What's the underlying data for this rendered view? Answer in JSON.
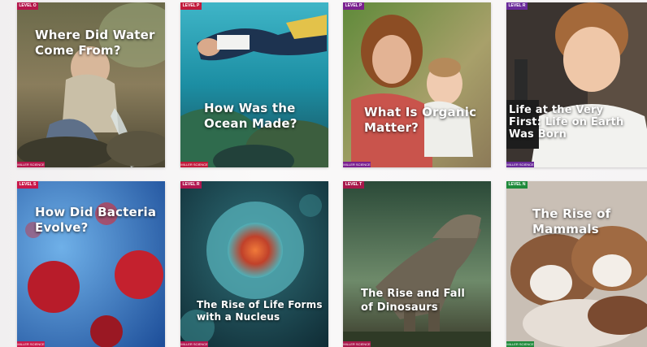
{
  "books": [
    {
      "level": "LEVEL O",
      "level_color": "#b5164b",
      "title_lines": [
        "Where Did Water",
        "Come From?"
      ],
      "brand": "MILLER SCIENCE",
      "brand_color": "#b5164b"
    },
    {
      "level": "LEVEL P",
      "level_color": "#c11a3b",
      "title_lines": [
        "How Was the",
        "Ocean Made?"
      ],
      "brand": "MILLER SCIENCE",
      "brand_color": "#c11a3b"
    },
    {
      "level": "LEVEL P",
      "level_color": "#7a1f8f",
      "title_lines": [
        "What Is Organic",
        "Matter?"
      ],
      "brand": "MILLER SCIENCE",
      "brand_color": "#7a1f8f"
    },
    {
      "level": "LEVEL R",
      "level_color": "#6a2a9a",
      "title_lines": [
        "Life at the Very",
        "First: Life on Earth",
        "Was Born"
      ],
      "brand": "MILLER SCIENCE",
      "brand_color": "#6a2a9a"
    },
    {
      "level": "LEVEL S",
      "level_color": "#c9184a",
      "title_lines": [
        "How Did Bacteria",
        "Evolve?"
      ],
      "brand": "MILLER SCIENCE",
      "brand_color": "#c9184a"
    },
    {
      "level": "LEVEL R",
      "level_color": "#b0164f",
      "title_lines": [
        "The Rise of Life Forms",
        "with a Nucleus"
      ],
      "brand": "MILLER SCIENCE",
      "brand_color": "#b0164f"
    },
    {
      "level": "LEVEL T",
      "level_color": "#a8174a",
      "title_lines": [
        "The Rise and Fall",
        "of Dinosaurs"
      ],
      "brand": "MILLER SCIENCE",
      "brand_color": "#a8174a"
    },
    {
      "level": "LEVEL N",
      "level_color": "#1f8a3b",
      "title_lines": [
        "The Rise of",
        "Mammals"
      ],
      "brand": "MILLER SCIENCE",
      "brand_color": "#1f8a3b"
    }
  ]
}
